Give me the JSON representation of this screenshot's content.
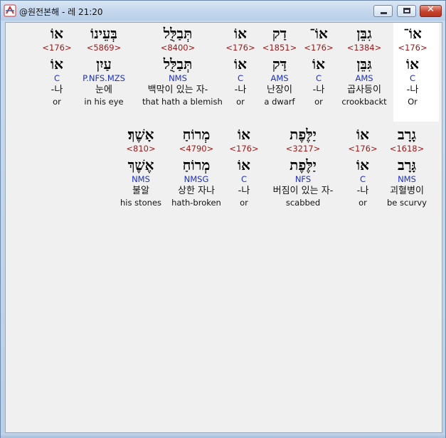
{
  "window": {
    "title": "@원전본해 - 레 21:20"
  },
  "rows": [
    [
      {
        "heb": "אוֹ־",
        "strong": "<176>",
        "heb2": "אוֹ",
        "morph": "C",
        "kor": "-나",
        "eng": "Or"
      },
      {
        "heb": "גִבֵּן",
        "strong": "<1384>",
        "heb2": "גִּבֵּן",
        "morph": "AMS",
        "kor": "곱사등이",
        "eng": "crookbackt"
      },
      {
        "heb": "אוֹ־",
        "strong": "<176>",
        "heb2": "אוֹ",
        "morph": "C",
        "kor": "-나",
        "eng": "or"
      },
      {
        "heb": "דַק",
        "strong": "<1851>",
        "heb2": "דַּק",
        "morph": "AMS",
        "kor": "난장이",
        "eng": "a dwarf"
      },
      {
        "heb": "אוֹ",
        "strong": "<176>",
        "heb2": "אוֹ",
        "morph": "C",
        "kor": "-나",
        "eng": "or"
      },
      {
        "heb": "תְּבַלֻּל",
        "strong": "<8400>",
        "heb2": "תְּבַלֻּל",
        "morph": "NMS",
        "kor": "백막이 있는 자-",
        "eng": "that hath a blemish"
      },
      {
        "heb": "בְּעֵינוֹ",
        "strong": "<5869>",
        "heb2": "עַיִן",
        "morph": "P.NFS.MZS",
        "kor": "눈에",
        "eng": "in his eye"
      },
      {
        "heb": "אוֹ",
        "strong": "<176>",
        "heb2": "אוֹ",
        "morph": "C",
        "kor": "-나",
        "eng": "or"
      }
    ],
    [
      {
        "heb": "גָרָב",
        "strong": "<1618>",
        "heb2": "גָּרָב",
        "morph": "NMS",
        "kor": "괴혈병이",
        "eng": "be scurvy"
      },
      {
        "heb": "אוֹ",
        "strong": "<176>",
        "heb2": "אוֹ",
        "morph": "C",
        "kor": "-나",
        "eng": "or"
      },
      {
        "heb": "יַלֶּפֶת",
        "strong": "<3217>",
        "heb2": "יַלֶּפֶת",
        "morph": "NFS",
        "kor": "버짐이 있는 자-",
        "eng": "scabbed"
      },
      {
        "heb": "אוֹ",
        "strong": "<176>",
        "heb2": "אוֹ",
        "morph": "C",
        "kor": "-나",
        "eng": "or"
      },
      {
        "heb": "מְרוֹחַ",
        "strong": "<4790>",
        "heb2": "מְרוֹחַ",
        "morph": "NMSG",
        "kor": "상한 자나",
        "eng": "hath-broken"
      },
      {
        "heb": "אָשֶׁךְ׃",
        "strong": "<810>",
        "heb2": "אֶשֶׁךְ",
        "morph": "NMS",
        "kor": "불알",
        "eng": "his stones"
      }
    ]
  ]
}
